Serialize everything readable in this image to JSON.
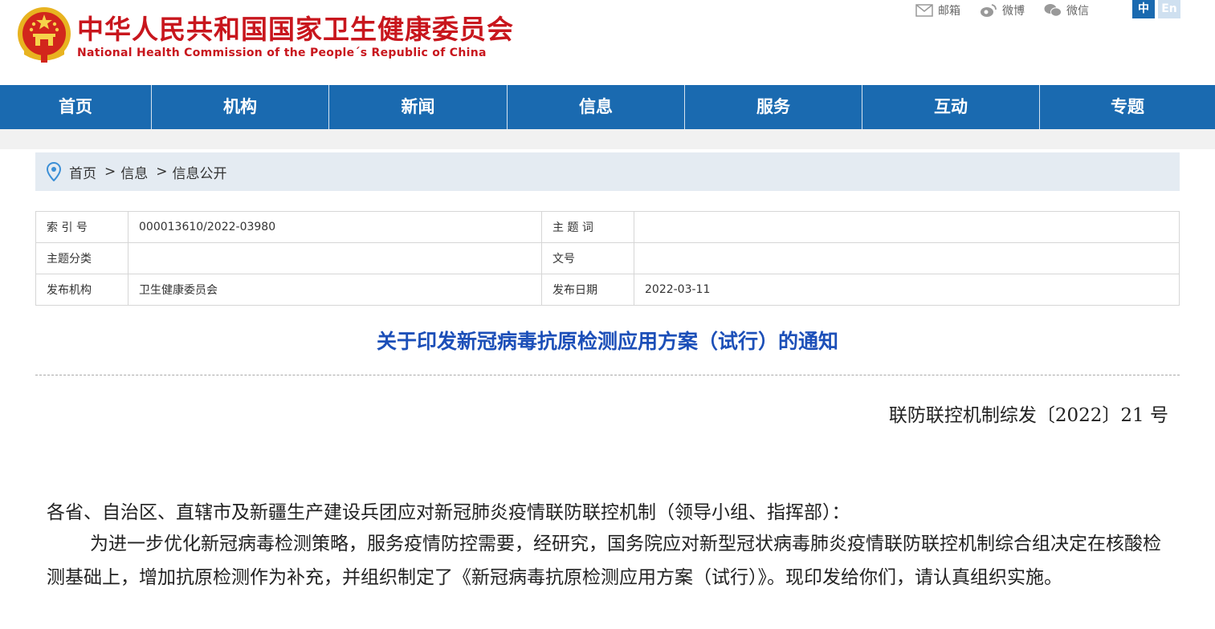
{
  "header": {
    "title_cn": "中华人民共和国国家卫生健康委员会",
    "title_en": "National Health Commission of the People´s Republic of China",
    "links": [
      {
        "label": "邮箱",
        "icon": "mail-icon"
      },
      {
        "label": "微博",
        "icon": "weibo-icon"
      },
      {
        "label": "微信",
        "icon": "wechat-icon"
      }
    ],
    "lang": {
      "zh": "中",
      "en": "En"
    }
  },
  "nav": [
    "首页",
    "机构",
    "新闻",
    "信息",
    "服务",
    "互动",
    "专题"
  ],
  "breadcrumb": [
    "首页",
    "信息",
    "信息公开"
  ],
  "breadcrumb_sep": ">",
  "meta": {
    "index_label": "索 引 号",
    "index_value": "000013610/2022-03980",
    "keyword_label": "主 题 词",
    "keyword_value": "",
    "category_label": "主题分类",
    "category_value": "",
    "docnum_label": "文号",
    "docnum_value": "",
    "org_label": "发布机构",
    "org_value": "卫生健康委员会",
    "date_label": "发布日期",
    "date_value": "2022-03-11"
  },
  "doc": {
    "title": "关于印发新冠病毒抗原检测应用方案（试行）的通知",
    "number": "联防联控机制综发〔2022〕21 号",
    "salutation": "各省、自治区、直辖市及新疆生产建设兵团应对新冠肺炎疫情联防联控机制（领导小组、指挥部）：",
    "paragraph": "为进一步优化新冠病毒检测策略，服务疫情防控需要，经研究，国务院应对新型冠状病毒肺炎疫情联防联控机制综合组决定在核酸检测基础上，增加抗原检测作为补充，并组织制定了《新冠病毒抗原检测应用方案（试行）》。现印发给你们，请认真组织实施。"
  },
  "colors": {
    "brand_red": "#c8161d",
    "nav_blue": "#1a6ab0",
    "title_blue": "#1c4fb8"
  }
}
